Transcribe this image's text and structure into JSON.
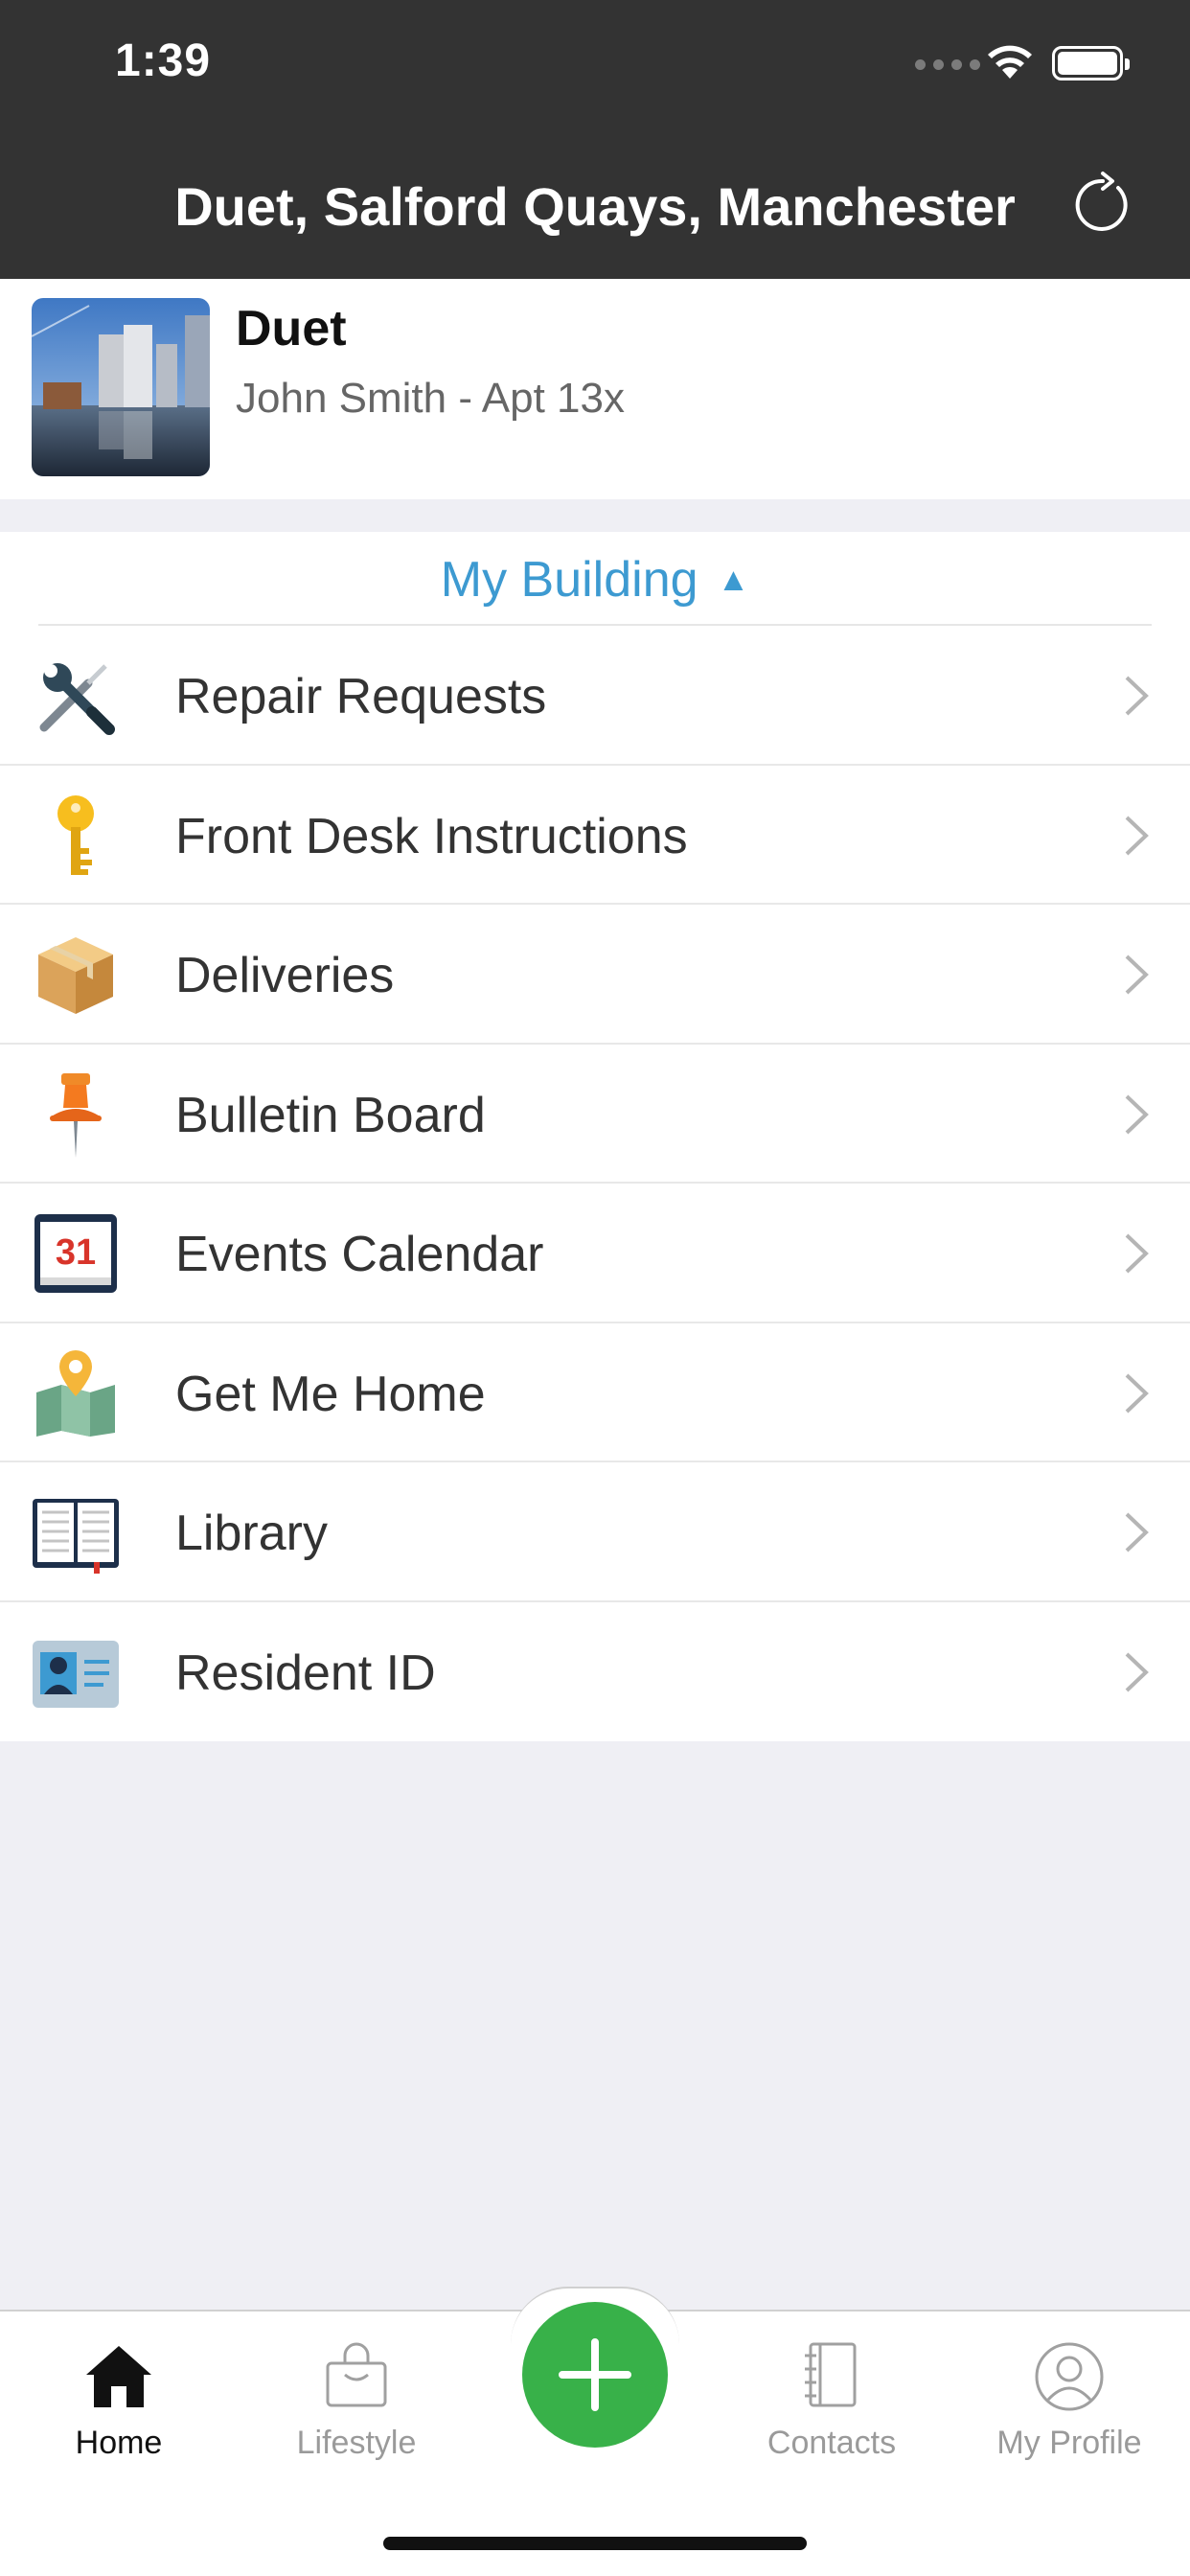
{
  "status_bar": {
    "time": "1:39"
  },
  "nav": {
    "title": "Duet, Salford Quays, Manchester"
  },
  "building": {
    "name": "Duet",
    "resident": "John Smith - Apt 13x"
  },
  "section": {
    "title": "My Building",
    "expanded_indicator": "▲"
  },
  "menu": [
    {
      "label": "Repair Requests",
      "icon": "tools-icon"
    },
    {
      "label": "Front Desk Instructions",
      "icon": "key-icon"
    },
    {
      "label": "Deliveries",
      "icon": "package-icon"
    },
    {
      "label": "Bulletin Board",
      "icon": "pushpin-icon"
    },
    {
      "label": "Events Calendar",
      "icon": "calendar-icon",
      "calendar_day": "31"
    },
    {
      "label": "Get Me Home",
      "icon": "map-pin-icon"
    },
    {
      "label": "Library",
      "icon": "book-icon"
    },
    {
      "label": "Resident ID",
      "icon": "id-card-icon"
    }
  ],
  "tabbar": {
    "items": [
      {
        "label": "Home",
        "icon": "home-icon",
        "active": true
      },
      {
        "label": "Lifestyle",
        "icon": "shopping-bag-icon",
        "active": false
      },
      {
        "label": "Contacts",
        "icon": "contacts-book-icon",
        "active": false
      },
      {
        "label": "My Profile",
        "icon": "profile-icon",
        "active": false
      }
    ],
    "fab_icon": "plus-icon"
  },
  "colors": {
    "header_bg": "#333333",
    "accent_blue": "#3d9ad1",
    "fab_green": "#38b149",
    "page_bg": "#efeff4"
  }
}
